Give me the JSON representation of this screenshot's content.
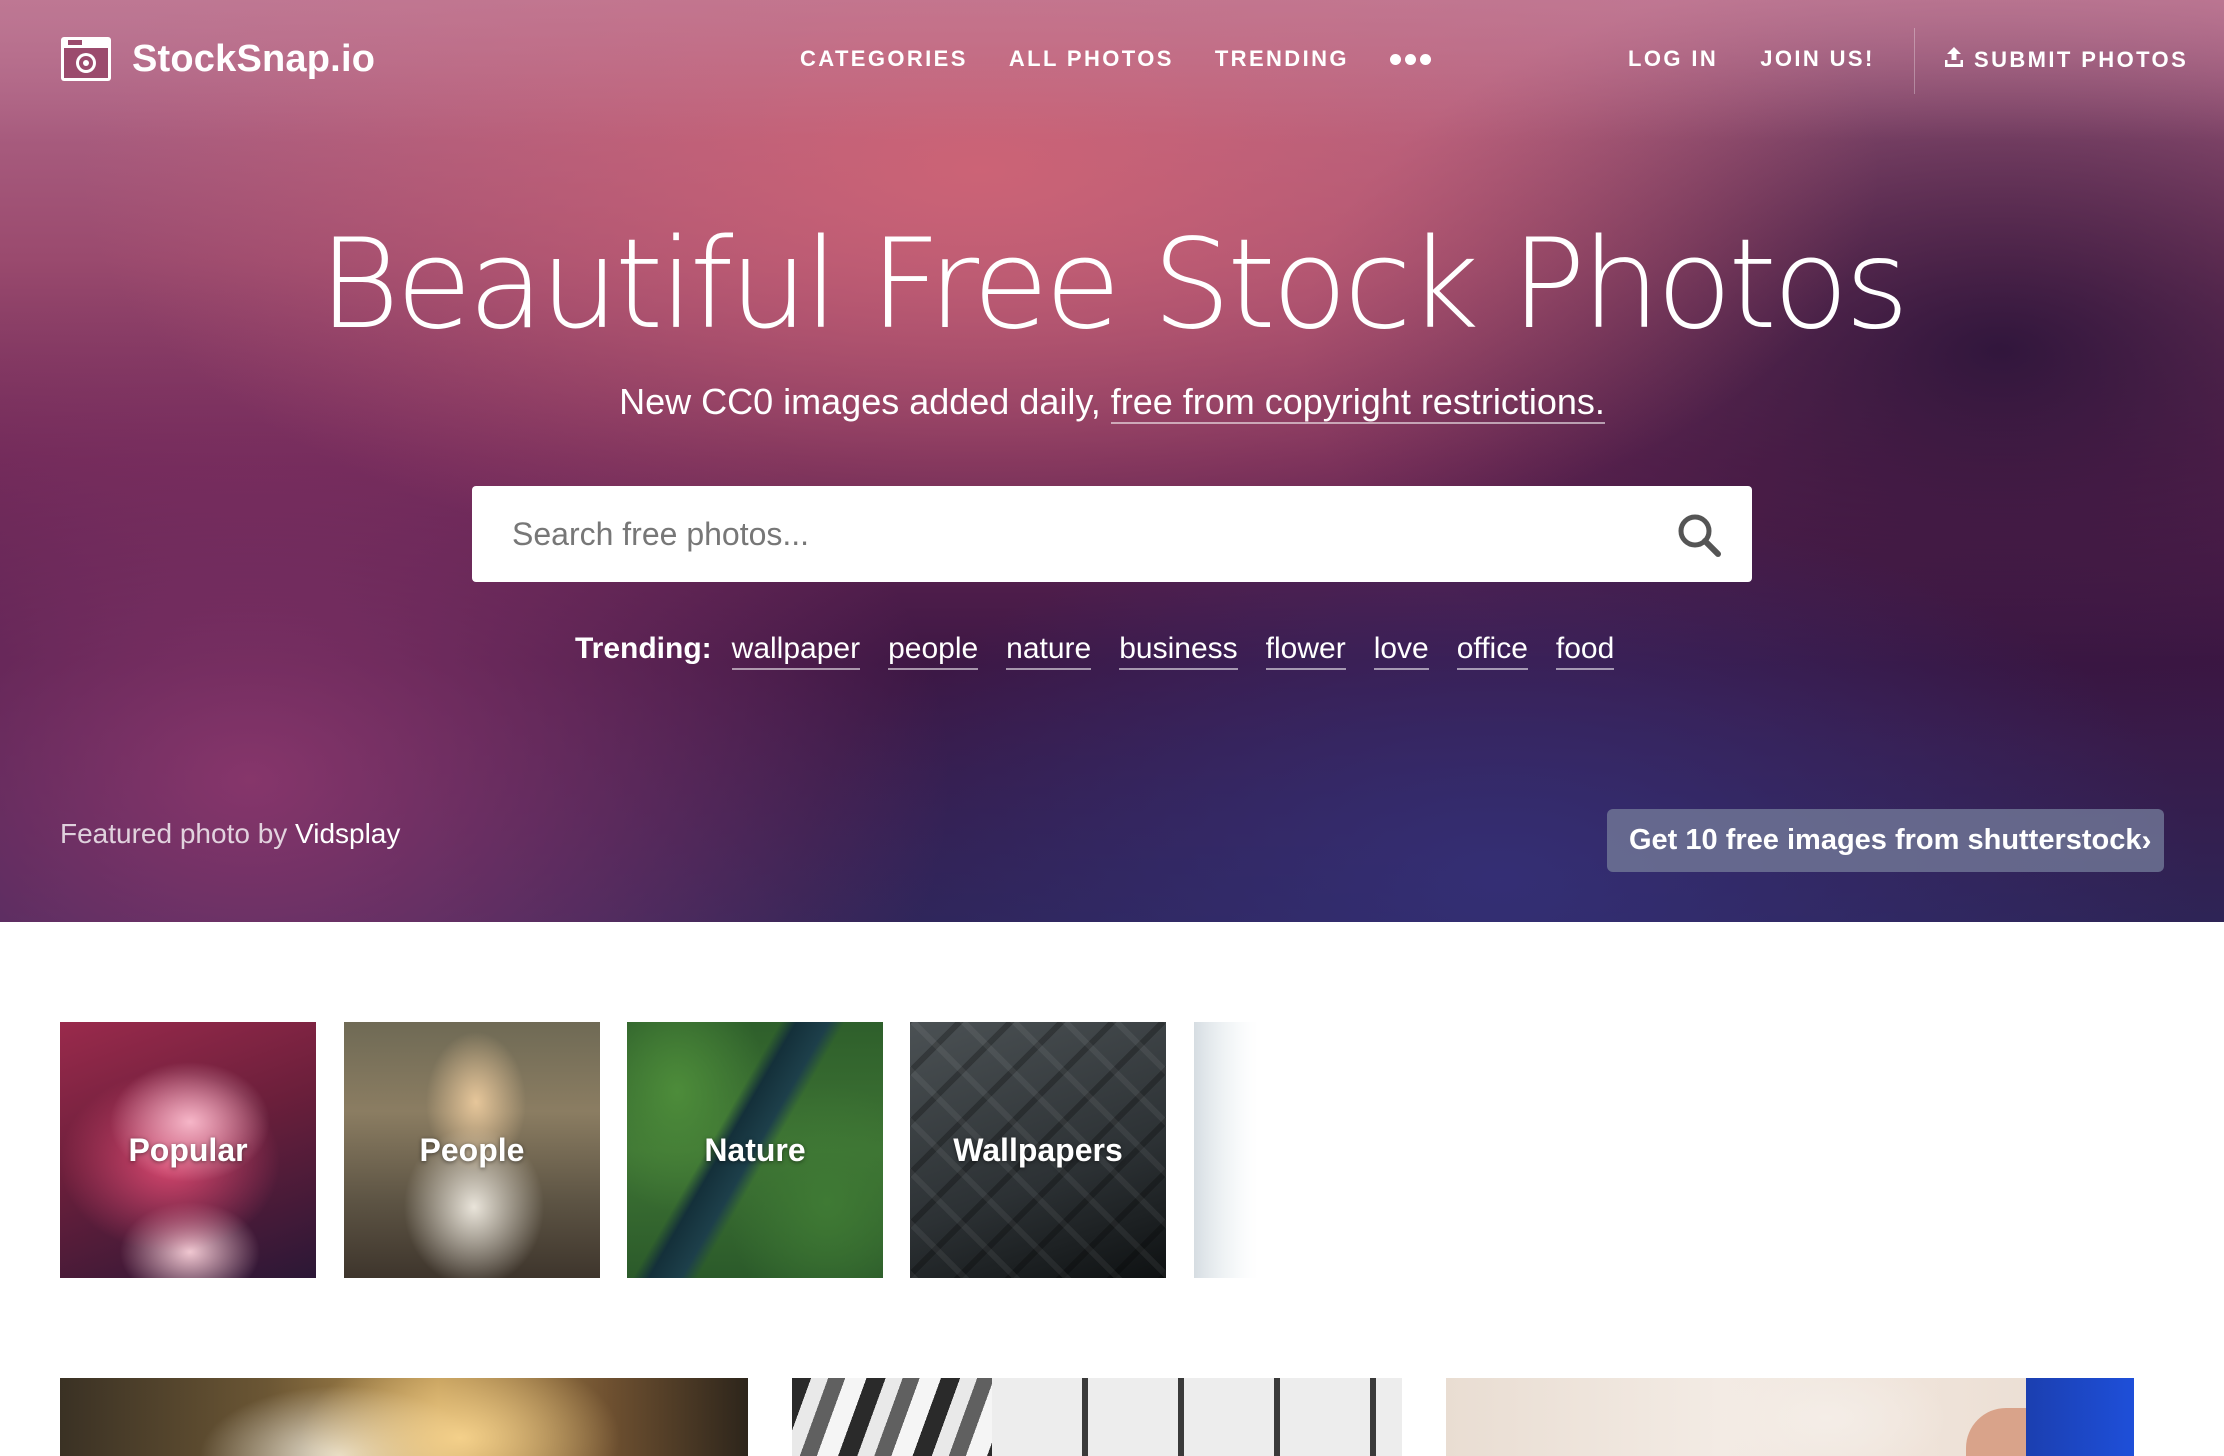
{
  "brand": {
    "name": "StockSnap.io"
  },
  "nav": {
    "center": [
      "CATEGORIES",
      "ALL PHOTOS",
      "TRENDING"
    ],
    "right": [
      "LOG IN",
      "JOIN US!"
    ],
    "submit": "SUBMIT PHOTOS"
  },
  "hero": {
    "title": "Beautiful Free Stock Photos",
    "subtitle_prefix": "New CC0 images added daily, ",
    "subtitle_link": "free from copyright restrictions."
  },
  "search": {
    "placeholder": "Search free photos..."
  },
  "trending": {
    "label": "Trending:",
    "tags": [
      "wallpaper",
      "people",
      "nature",
      "business",
      "flower",
      "love",
      "office",
      "food"
    ]
  },
  "featured": {
    "prefix": "Featured photo by ",
    "author": "Vidsplay"
  },
  "promo": {
    "label": "Get 10 free images from shutterstock"
  },
  "categories": [
    "Popular",
    "People",
    "Nature",
    "Wallpapers"
  ],
  "colors": {
    "promo_bg": "#70769a",
    "hero_top": "#b66f8f",
    "hero_bottom": "#2e2456"
  }
}
